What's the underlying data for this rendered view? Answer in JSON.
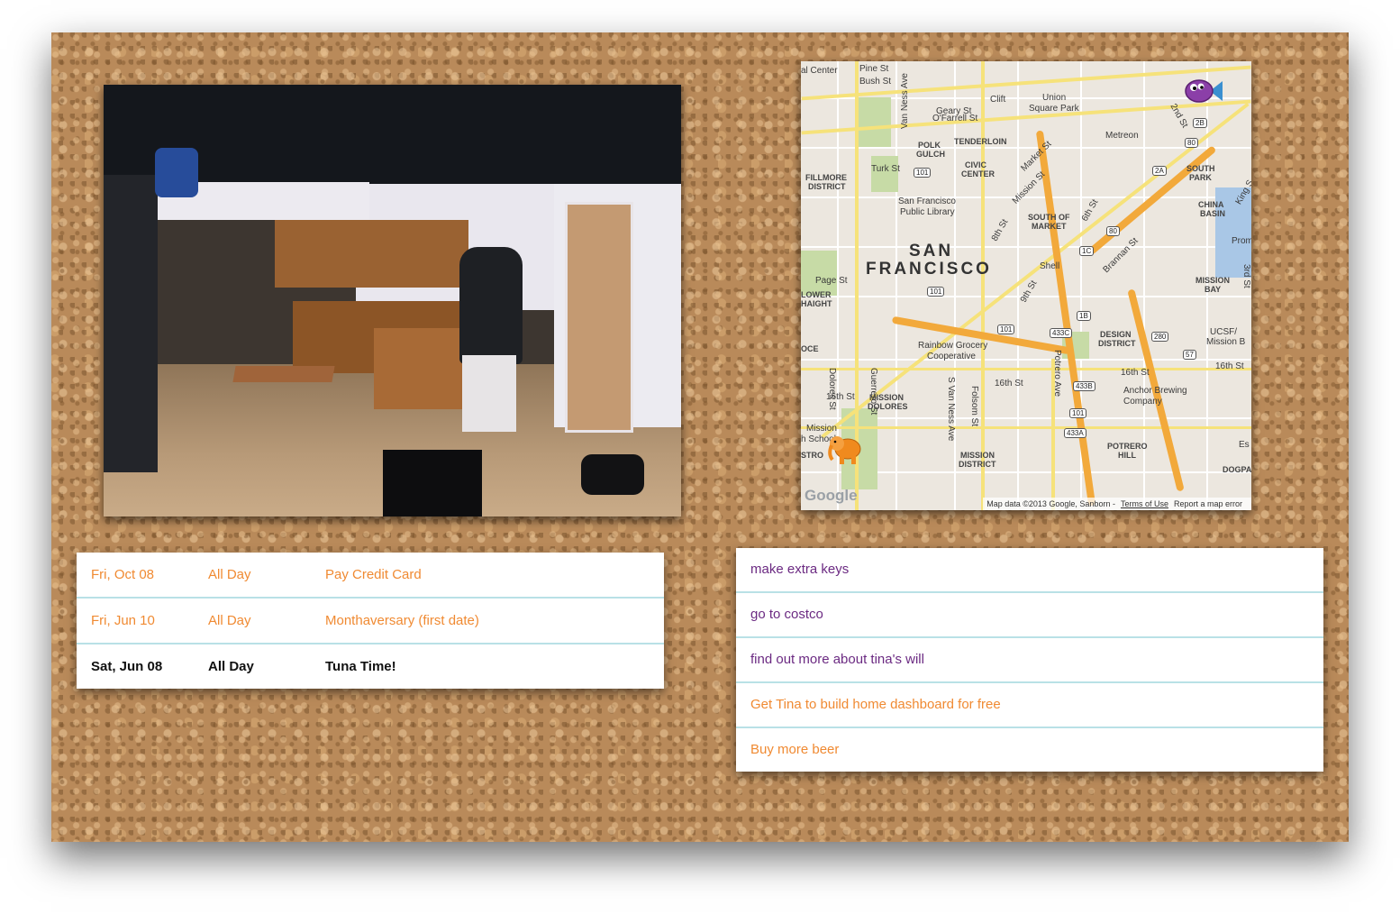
{
  "colors": {
    "cork": "#b98a5a",
    "past_event": "#f08a32",
    "current_event": "#111111",
    "todo_purple": "#6b2a82",
    "todo_orange": "#f08a32",
    "divider": "#b9e1e6"
  },
  "map": {
    "city_line1": "SAN",
    "city_line2": "FRANCISCO",
    "labels": {
      "pine": "Pine St",
      "bush": "Bush St",
      "geary": "Geary St",
      "ofarrell": "O'Farrell St",
      "clift": "Clift",
      "union_square": "Union",
      "union_square2": "Square Park",
      "metreon": "Metreon",
      "polk_gulch": "POLK",
      "polk_gulch2": "GULCH",
      "tenderloin": "TENDERLOIN",
      "market": "Market St",
      "turk": "Turk St",
      "fillmore": "FILLMORE",
      "fillmore2": "DISTRICT",
      "civic": "CIVIC",
      "civic2": "CENTER",
      "sf_library": "San Francisco",
      "sf_library2": "Public Library",
      "mission_st": "Mission St",
      "south_of_market": "SOUTH OF",
      "south_of_market2": "MARKET",
      "south_park": "SOUTH",
      "south_park2": "PARK",
      "china_basin": "CHINA",
      "china_basin2": "BASIN",
      "page": "Page St",
      "lower_haight": "LOWER",
      "lower_haight2": "HAIGHT",
      "shell": "Shell",
      "eighth": "8th St",
      "ninth": "9th St",
      "sixth": "6th St",
      "brannan": "Brannan St",
      "mission_bay": "MISSION",
      "mission_bay2": "BAY",
      "rainbow": "Rainbow Grocery",
      "rainbow2": "Cooperative",
      "dolores": "Dolores St",
      "guerrero": "Guerrero St",
      "s_van_ness": "S Van Ness Ave",
      "folsom": "Folsom St",
      "potrero_ave": "Potrero Ave",
      "design_district": "DESIGN",
      "design_district2": "DISTRICT",
      "ucsf": "UCSF/",
      "ucsf2": "Mission B",
      "sixteenth_a": "16th St",
      "sixteenth_b": "16th St",
      "sixteenth_c": "16th St",
      "sixteenth_d": "16th St",
      "mission_dolores": "MISSION",
      "mission_dolores2": "DOLORES",
      "anchor": "Anchor Brewing",
      "anchor2": "Company",
      "mission_high": "Mission",
      "mission_high2": "h School",
      "mission_district": "MISSION",
      "mission_district2": "DISTRICT",
      "potrero_hill": "POTRERO",
      "potrero_hill2": "HILL",
      "dogpatch": "DOGPA",
      "second": "2nd St",
      "king": "King S",
      "third": "3rd St",
      "van_ness": "Van Ness Ave",
      "al_center": "al Center",
      "oce": "OCE",
      "stro": "STRO",
      "prom": "Prom",
      "es": "Es"
    },
    "shields": [
      "101",
      "101",
      "101",
      "101",
      "80",
      "80",
      "280",
      "1B",
      "1C",
      "2A",
      "2B",
      "433C",
      "433B",
      "433A",
      "57"
    ],
    "google": "Google",
    "attribution": "Map data ©2013 Google, Sanborn -",
    "terms": "Terms of Use",
    "report": "Report a map error"
  },
  "events": [
    {
      "date": "Fri, Oct 08",
      "time": "All Day",
      "title": "Pay Credit Card",
      "state": "past"
    },
    {
      "date": "Fri, Jun 10",
      "time": "All Day",
      "title": "Monthaversary (first date)",
      "state": "past"
    },
    {
      "date": "Sat, Jun 08",
      "time": "All Day",
      "title": "Tuna Time!",
      "state": "current"
    }
  ],
  "todos": [
    {
      "text": "make extra keys",
      "color": "#6b2a82"
    },
    {
      "text": "go to costco",
      "color": "#6b2a82"
    },
    {
      "text": "find out more about tina's will",
      "color": "#6b2a82"
    },
    {
      "text": "Get Tina to build home dashboard for free",
      "color": "#f08a32"
    },
    {
      "text": "Buy more beer",
      "color": "#f08a32"
    }
  ]
}
